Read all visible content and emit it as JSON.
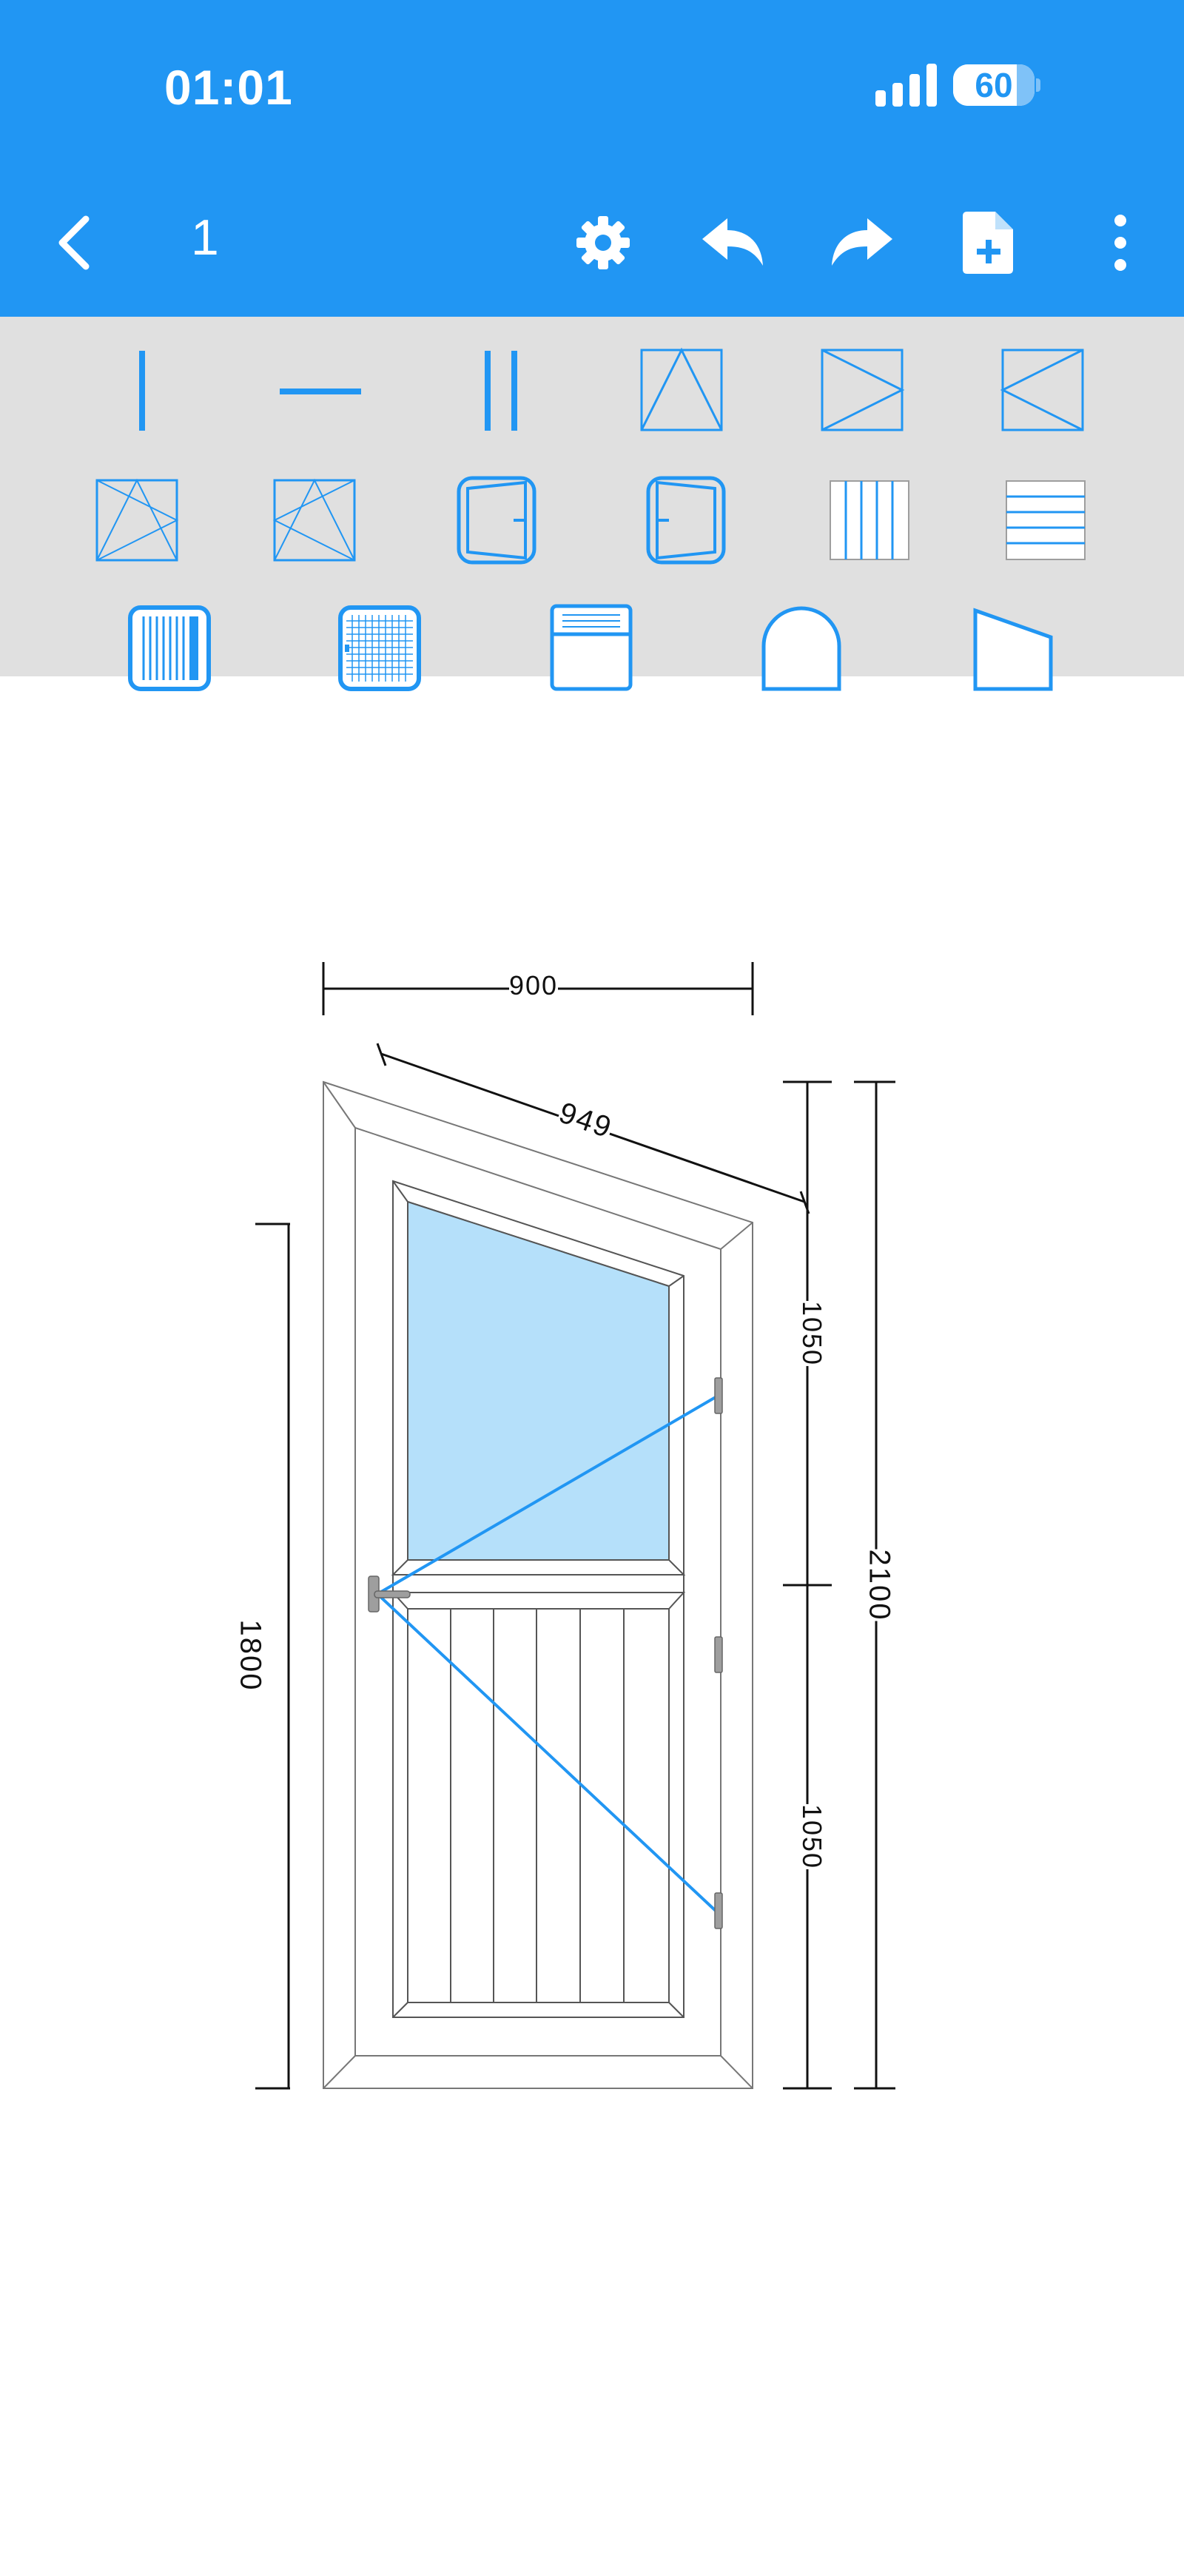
{
  "status_bar": {
    "time": "01:01",
    "battery_level": "60"
  },
  "toolbar": {
    "title": "1",
    "back_icon": "chevron-left-icon",
    "settings_icon": "gear-icon",
    "undo_icon": "undo-icon",
    "redo_icon": "redo-icon",
    "new_file_icon": "file-plus-icon",
    "more_icon": "more-vertical-icon"
  },
  "palette": {
    "rows": [
      [
        "vertical-mullion",
        "horizontal-transom",
        "double-mullion",
        "top-hung-sash",
        "side-hung-sash-right",
        "side-hung-sash-left"
      ],
      [
        "tilt-turn-sash-left",
        "tilt-turn-sash-right",
        "door-leaf-right",
        "door-leaf-left",
        "vertical-panels",
        "horizontal-panels"
      ],
      [
        "vertical-blind",
        "mosquito-net",
        "roller-shutter-box",
        "arch-shape",
        "slanted-top-shape"
      ]
    ]
  },
  "drawing": {
    "dimensions": {
      "width_top": "900",
      "slope": "949",
      "height_upper_section": "1050",
      "height_lower_section": "1050",
      "height_total": "2100",
      "height_handle": "1800"
    },
    "colors": {
      "frame_line": "#777777",
      "glass_fill": "#b5e0fa",
      "opening_line": "#2196F3",
      "hardware": "#9e9e9e"
    }
  }
}
